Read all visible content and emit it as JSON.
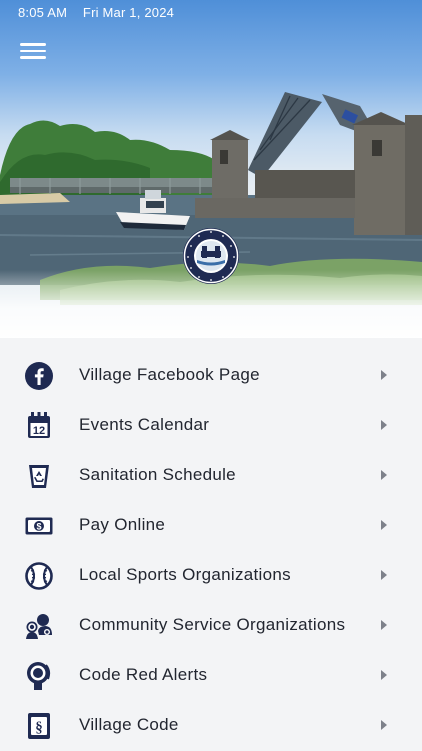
{
  "status_bar": {
    "time": "8:05 AM",
    "date": "Fri Mar 1, 2024"
  },
  "header": {
    "menu_icon": "hamburger-menu-icon"
  },
  "hero": {
    "seal_icon": "village-seal-logo"
  },
  "colors": {
    "accent": "#1f2a52",
    "background": "#f3f4f6",
    "text": "#222630",
    "chevron": "#7d818a"
  },
  "menu": {
    "items": [
      {
        "label": "Village Facebook Page",
        "icon": "facebook-icon"
      },
      {
        "label": "Events Calendar",
        "icon": "calendar-icon"
      },
      {
        "label": "Sanitation Schedule",
        "icon": "recycle-bin-icon"
      },
      {
        "label": "Pay Online",
        "icon": "dollar-bill-icon"
      },
      {
        "label": "Local Sports Organizations",
        "icon": "baseball-icon"
      },
      {
        "label": "Community Service Organizations",
        "icon": "community-people-icon"
      },
      {
        "label": "Code Red Alerts",
        "icon": "alarm-bell-icon"
      },
      {
        "label": "Village Code",
        "icon": "legal-code-icon"
      }
    ]
  }
}
